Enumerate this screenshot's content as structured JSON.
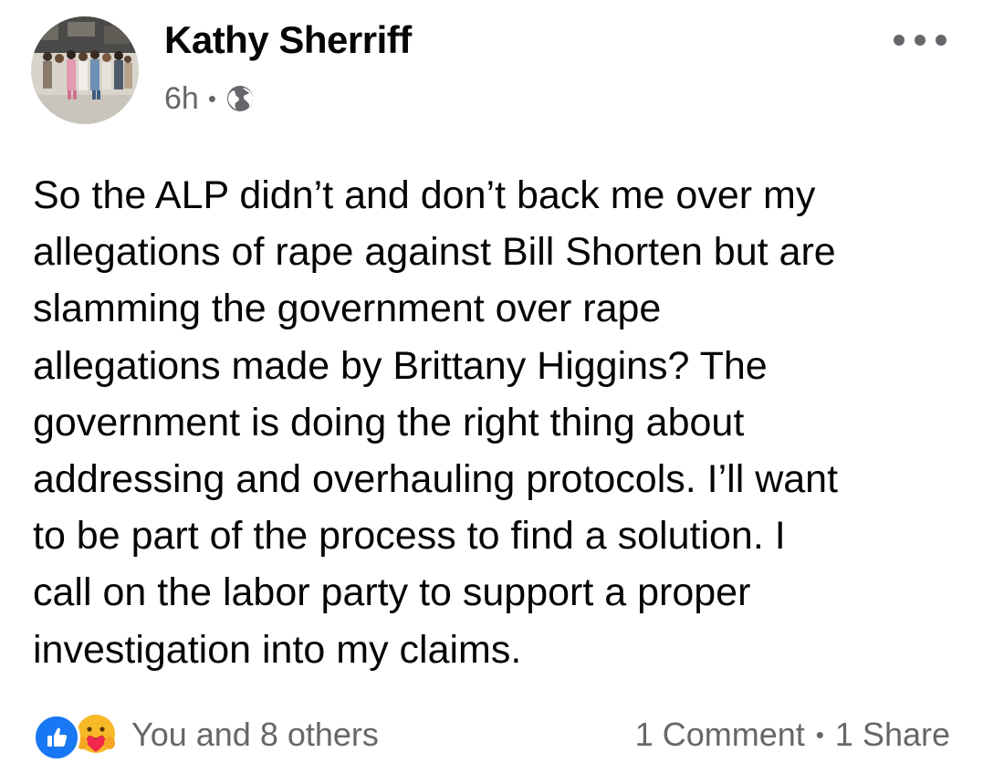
{
  "post": {
    "author": "Kathy Sherriff",
    "timestamp": "6h",
    "privacy_icon": "globe-icon",
    "menu_icon": "more-options-icon",
    "text_lines": [
      "So the ALP didn’t and don’t back me over my",
      "allegations of rape against Bill Shorten but are",
      "slamming the government over rape",
      "allegations made by Brittany Higgins? The",
      "government is doing the right thing about",
      "addressing and overhauling protocols. I’ll want",
      "to be part of the process to find a solution. I",
      "call on the labor party to support a proper",
      "investigation into my claims."
    ]
  },
  "footer": {
    "reaction_icons": [
      "like-icon",
      "care-icon"
    ],
    "reactions_text": "You and 8 others",
    "comments_text": "1 Comment",
    "shares_text": "1 Share"
  },
  "colors": {
    "like_blue": "#1877f2",
    "care_yellow": "#f7b928",
    "care_red": "#f02849",
    "secondary_text": "#65676b",
    "primary_text": "#050505"
  }
}
